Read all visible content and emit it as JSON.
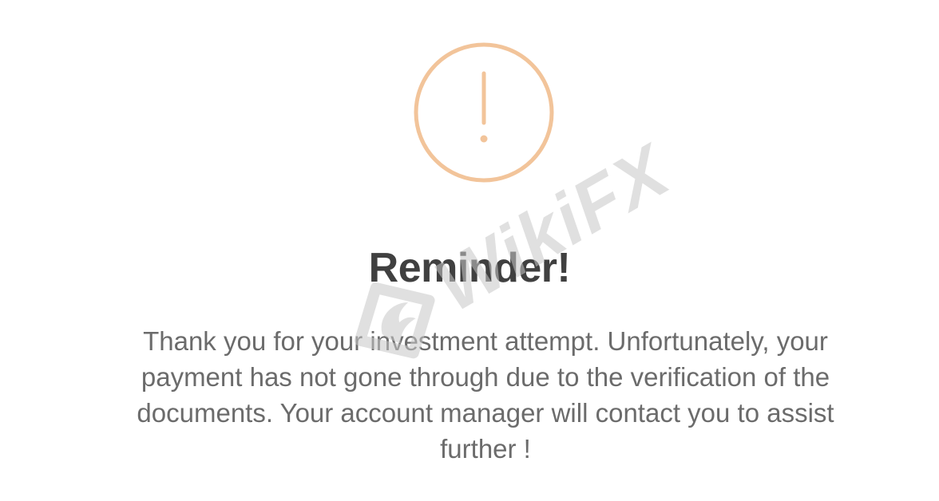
{
  "dialog": {
    "icon": "exclamation-circle-icon",
    "icon_color": "#f2c49a",
    "title": "Reminder!",
    "message": "Thank you for your investment attempt. Unfortunately, your payment has not gone through due to the verification of the documents. Your account manager will contact you to assist further !"
  },
  "watermark": {
    "text": "WikiFX",
    "logo": "wikifx-eagle-logo",
    "color": "#c8c8c8"
  }
}
